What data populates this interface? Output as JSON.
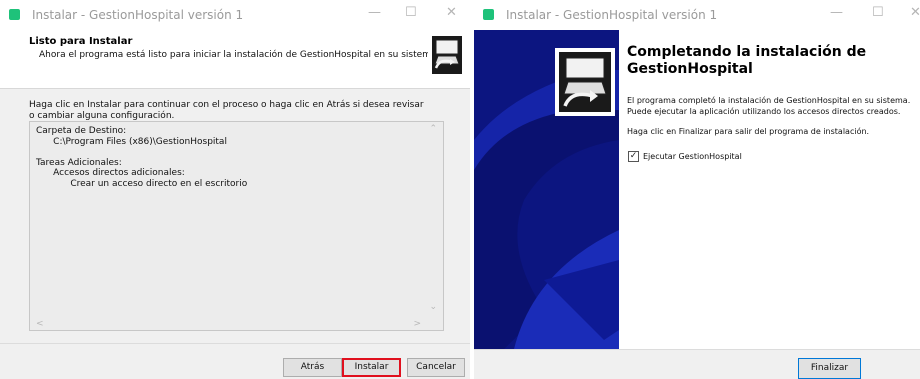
{
  "window1": {
    "title": "Instalar - GestionHospital versión 1",
    "controls": {
      "minimize": "—",
      "maximize": "☐",
      "close": "✕"
    },
    "header": {
      "title": "Listo para Instalar",
      "subtitle": "Ahora el programa está listo para iniciar la instalación de GestionHospital en su sistema."
    },
    "instructions": "Haga clic en Instalar para continuar con el proceso o haga clic en Atrás si desea revisar o cambiar alguna configuración.",
    "memo": {
      "lines": [
        "Carpeta de Destino:",
        "      C:\\Program Files (x86)\\GestionHospital",
        "",
        "Tareas Adicionales:",
        "      Accesos directos adicionales:",
        "            Crear un acceso directo en el escritorio"
      ]
    },
    "buttons": {
      "back": "Atrás",
      "install": "Instalar",
      "cancel": "Cancelar"
    }
  },
  "window2": {
    "title": "Instalar - GestionHospital versión 1",
    "controls": {
      "minimize": "—",
      "maximize": "☐",
      "close": "✕"
    },
    "heading": "Completando la instalación de GestionHospital",
    "paragraph1": "El programa completó la instalación de GestionHospital en su sistema. Puede ejecutar la aplicación utilizando los accesos directos creados.",
    "paragraph2": "Haga clic en Finalizar para salir del programa de instalación.",
    "checkbox": {
      "label": "Ejecutar GestionHospital",
      "checked": true
    },
    "buttons": {
      "finish": "Finalizar"
    }
  },
  "colors": {
    "accent": "#0078d7",
    "highlight": "#e0101e",
    "sidebar": "#0c1580",
    "app_icon": "#1ec27a"
  },
  "icons": [
    "app-icon",
    "installer-logo-icon",
    "installer-sidebar-image"
  ]
}
